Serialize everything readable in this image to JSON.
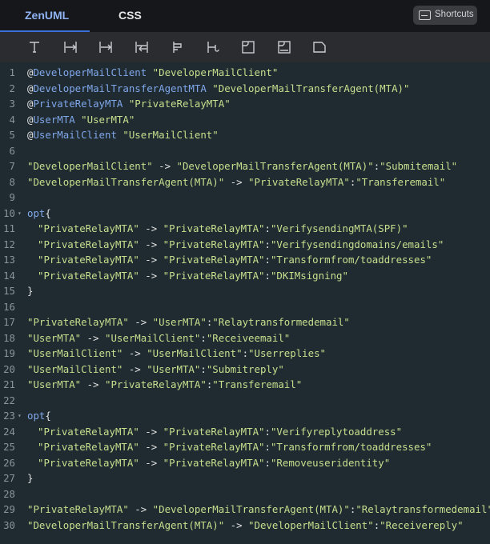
{
  "tabs": [
    {
      "label": "ZenUML",
      "active": true
    },
    {
      "label": "CSS",
      "active": false
    }
  ],
  "shortcuts_label": "Shortcuts",
  "toolbar_icons": [
    "participant-icon",
    "message-icon",
    "async-message-icon",
    "return-message-icon",
    "alt-icon",
    "loop-icon",
    "fragment-icon",
    "log-icon",
    "note-icon"
  ],
  "colors": {
    "accent": "#3a6fd8",
    "string": "#c8df8e",
    "variable": "#80a7ea",
    "text": "#e3e3e3",
    "gutter": "#8b949a"
  },
  "code_lines": [
    {
      "n": "1",
      "text": "@DeveloperMailClient \"DeveloperMailClient\""
    },
    {
      "n": "2",
      "text": "@DeveloperMailTransferAgentMTA \"DeveloperMailTransferAgent(MTA)\""
    },
    {
      "n": "3",
      "text": "@PrivateRelayMTA \"PrivateRelayMTA\""
    },
    {
      "n": "4",
      "text": "@UserMTA \"UserMTA\""
    },
    {
      "n": "5",
      "text": "@UserMailClient \"UserMailClient\""
    },
    {
      "n": "6",
      "text": ""
    },
    {
      "n": "7",
      "text": "\"DeveloperMailClient\" -> \"DeveloperMailTransferAgent(MTA)\":\"Submitemail\""
    },
    {
      "n": "8",
      "text": "\"DeveloperMailTransferAgent(MTA)\" -> \"PrivateRelayMTA\":\"Transferemail\""
    },
    {
      "n": "9",
      "text": ""
    },
    {
      "n": "10",
      "text": "opt{",
      "fold": true
    },
    {
      "n": "11",
      "text": "\"PrivateRelayMTA\" -> \"PrivateRelayMTA\":\"VerifysendingMTA(SPF)\"",
      "indent": true
    },
    {
      "n": "12",
      "text": "\"PrivateRelayMTA\" -> \"PrivateRelayMTA\":\"Verifysendingdomains/emails\"",
      "indent": true
    },
    {
      "n": "13",
      "text": "\"PrivateRelayMTA\" -> \"PrivateRelayMTA\":\"Transformfrom/toaddresses\"",
      "indent": true
    },
    {
      "n": "14",
      "text": "\"PrivateRelayMTA\" -> \"PrivateRelayMTA\":\"DKIMsigning\"",
      "indent": true
    },
    {
      "n": "15",
      "text": "}"
    },
    {
      "n": "16",
      "text": ""
    },
    {
      "n": "17",
      "text": "\"PrivateRelayMTA\" -> \"UserMTA\":\"Relaytransformedemail\""
    },
    {
      "n": "18",
      "text": "\"UserMTA\" -> \"UserMailClient\":\"Receiveemail\""
    },
    {
      "n": "19",
      "text": "\"UserMailClient\" -> \"UserMailClient\":\"Userreplies\""
    },
    {
      "n": "20",
      "text": "\"UserMailClient\" -> \"UserMTA\":\"Submitreply\""
    },
    {
      "n": "21",
      "text": "\"UserMTA\" -> \"PrivateRelayMTA\":\"Transferemail\""
    },
    {
      "n": "22",
      "text": ""
    },
    {
      "n": "23",
      "text": "opt{",
      "fold": true
    },
    {
      "n": "24",
      "text": "\"PrivateRelayMTA\" -> \"PrivateRelayMTA\":\"Verifyreplytoaddress\"",
      "indent": true
    },
    {
      "n": "25",
      "text": "\"PrivateRelayMTA\" -> \"PrivateRelayMTA\":\"Transformfrom/toaddresses\"",
      "indent": true
    },
    {
      "n": "26",
      "text": "\"PrivateRelayMTA\" -> \"PrivateRelayMTA\":\"Removeuseridentity\"",
      "indent": true
    },
    {
      "n": "27",
      "text": "}"
    },
    {
      "n": "28",
      "text": ""
    },
    {
      "n": "29",
      "text": "\"PrivateRelayMTA\" -> \"DeveloperMailTransferAgent(MTA)\":\"Relaytransformedemail\""
    },
    {
      "n": "30",
      "text": "\"DeveloperMailTransferAgent(MTA)\" -> \"DeveloperMailClient\":\"Receivereply\""
    }
  ]
}
